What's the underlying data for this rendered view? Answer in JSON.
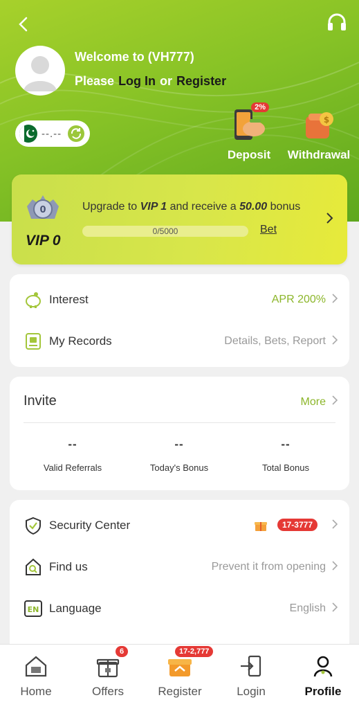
{
  "header": {
    "welcome": "Welcome to (VH777)",
    "please": "Please",
    "login": "Log In",
    "or": "or",
    "register": "Register",
    "balance": "--.--",
    "deposit": "Deposit",
    "withdrawal": "Withdrawal",
    "deposit_badge": "2%"
  },
  "vip": {
    "level": "VIP 0",
    "medal_number": "0",
    "upgrade_prefix": "Upgrade to",
    "upgrade_target": "VIP 1",
    "upgrade_mid": "and receive a",
    "bonus": "50.00",
    "upgrade_suffix": "bonus",
    "progress_text": "0/5000",
    "progress_fraction": 0,
    "bet_link": "Bet"
  },
  "records": [
    {
      "label": "Interest",
      "value": "APR 200%",
      "icon": "piggy-bank-icon"
    },
    {
      "label": "My Records",
      "value": "Details, Bets, Report",
      "icon": "records-icon"
    }
  ],
  "invite": {
    "title": "Invite",
    "more": "More",
    "stats": [
      {
        "value": "--",
        "caption": "Valid Referrals"
      },
      {
        "value": "--",
        "caption": "Today's Bonus"
      },
      {
        "value": "--",
        "caption": "Total Bonus"
      }
    ]
  },
  "settings": [
    {
      "label": "Security Center",
      "value": "",
      "badge": "17-3777",
      "icon": "shield-icon"
    },
    {
      "label": "Find us",
      "value": "Prevent it from opening",
      "icon": "find-us-icon"
    },
    {
      "label": "Language",
      "value": "English",
      "icon": "language-icon",
      "icon_text": "EN"
    }
  ],
  "tabbar": [
    {
      "label": "Home",
      "icon": "home-icon"
    },
    {
      "label": "Offers",
      "icon": "gift-icon",
      "badge": "6"
    },
    {
      "label": "Register",
      "icon": "register-gift-icon",
      "badge": "17-2,777"
    },
    {
      "label": "Login",
      "icon": "login-icon"
    },
    {
      "label": "Profile",
      "icon": "profile-icon",
      "active": true
    }
  ],
  "colors": {
    "accent": "#8cb62a",
    "badge": "#e53935",
    "hero": "#86c226"
  }
}
